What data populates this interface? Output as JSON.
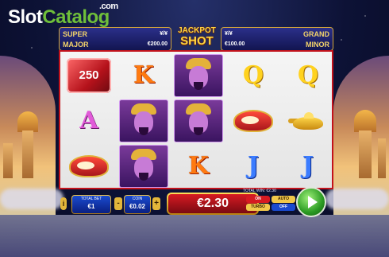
{
  "brand": {
    "logo_slot": "Slot",
    "logo_catalog": "Catalog",
    "logo_com": ".com"
  },
  "jackpots": {
    "center_line1": "JACKPOT",
    "center_line2": "SHOT",
    "super_label": "SUPER",
    "super_value": "¥/¥",
    "major_label": "MAJOR",
    "major_value": "€200.00",
    "grand_label": "GRAND",
    "grand_value": "¥/¥",
    "minor_label": "MINOR",
    "minor_value": "€100.00"
  },
  "reels": [
    [
      "250",
      "A",
      "slipper"
    ],
    [
      "K",
      "genie",
      "genie"
    ],
    [
      "genie",
      "genie",
      "K"
    ],
    [
      "Q",
      "slipper",
      "J"
    ],
    [
      "Q",
      "lamp",
      "J"
    ]
  ],
  "controls": {
    "info": "i",
    "total_bet_label": "TOTAL BET",
    "total_bet_value": "€1",
    "coin_label": "COIN",
    "coin_value": "€0.02",
    "minus": "-",
    "plus": "+",
    "win_display": "€2.30",
    "total_win_label": "TOTAL WIN: €2.30",
    "turbo_on": "ON",
    "turbo_label": "TURBO",
    "auto_label": "AUTO",
    "auto_state": "OFF"
  },
  "colors": {
    "accent_gold": "#e3b63a",
    "reel_border": "#c2121b",
    "spin_green": "#2a9a22"
  }
}
